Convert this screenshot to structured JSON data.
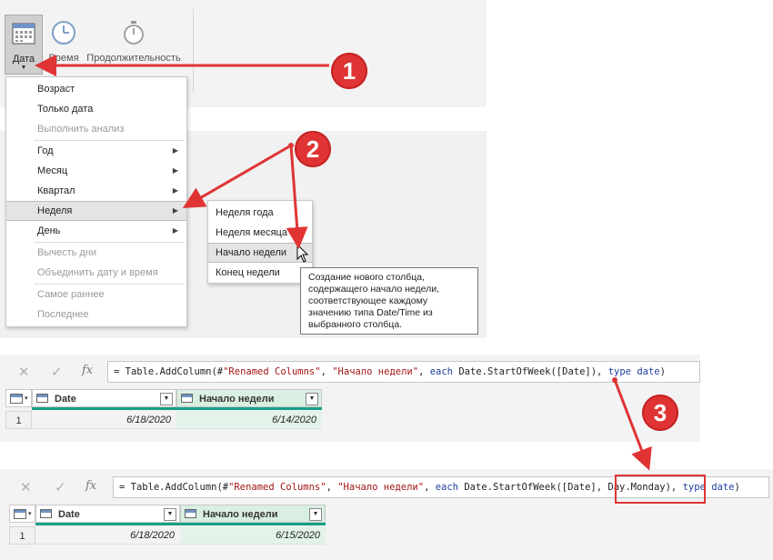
{
  "ribbon": {
    "buttons": [
      {
        "label": "Дата",
        "icon": "calendar-icon"
      },
      {
        "label": "Время",
        "icon": "clock-icon"
      },
      {
        "label": "Продолжительность",
        "icon": "stopwatch-icon"
      }
    ]
  },
  "date_menu": {
    "items": [
      {
        "label": "Возраст"
      },
      {
        "label": "Только дата"
      },
      {
        "label": "Выполнить анализ"
      },
      {
        "label": "Год"
      },
      {
        "label": "Месяц"
      },
      {
        "label": "Квартал"
      },
      {
        "label": "Неделя"
      },
      {
        "label": "День"
      },
      {
        "label": "Вычесть дни"
      },
      {
        "label": "Объединить дату и время"
      },
      {
        "label": "Самое раннее"
      },
      {
        "label": "Последнее"
      }
    ]
  },
  "week_submenu": {
    "items": [
      {
        "label": "Неделя года"
      },
      {
        "label": "Неделя месяца"
      },
      {
        "label": "Начало недели"
      },
      {
        "label": "Конец недели"
      }
    ]
  },
  "tooltip": {
    "lines": [
      "Создание нового столбца,",
      "содержащего начало недели,",
      "соответствующее каждому",
      "значению типа Date/Time из",
      "выбранного столбца."
    ]
  },
  "formula1": {
    "p1": "= Table.AddColumn(#",
    "s1": "\"Renamed Columns\"",
    "p2": ", ",
    "s2": "\"Начало недели\"",
    "p3": ", ",
    "k1": "each",
    "p4": " Date.StartOfWeek([Date]), ",
    "k2": "type",
    "p5": " ",
    "k3": "date",
    "p6": ")"
  },
  "formula2": {
    "p1": "= Table.AddColumn(#",
    "s1": "\"Renamed Columns\"",
    "p2": ", ",
    "s2": "\"Начало недели\"",
    "p3": ", ",
    "k1": "each",
    "p4": " Date.StartOfWeek([Date], Day.Monday), ",
    "k2": "type",
    "p5": " ",
    "k3": "date",
    "p6": ")"
  },
  "grid1": {
    "columns": [
      "Date",
      "Начало недели"
    ],
    "rows": [
      {
        "num": "1",
        "date": "6/18/2020",
        "week_start": "6/14/2020"
      }
    ]
  },
  "grid2": {
    "columns": [
      "Date",
      "Начало недели"
    ],
    "rows": [
      {
        "num": "1",
        "date": "6/18/2020",
        "week_start": "6/15/2020"
      }
    ]
  },
  "formula_icons": {
    "cancel": "✕",
    "commit": "✓",
    "fx": "fx"
  },
  "callouts": [
    "1",
    "2",
    "3"
  ],
  "colors": {
    "callout_red": "#e03434",
    "column_bar": "#16a085",
    "new_column_fill": "#e3f3e9"
  }
}
